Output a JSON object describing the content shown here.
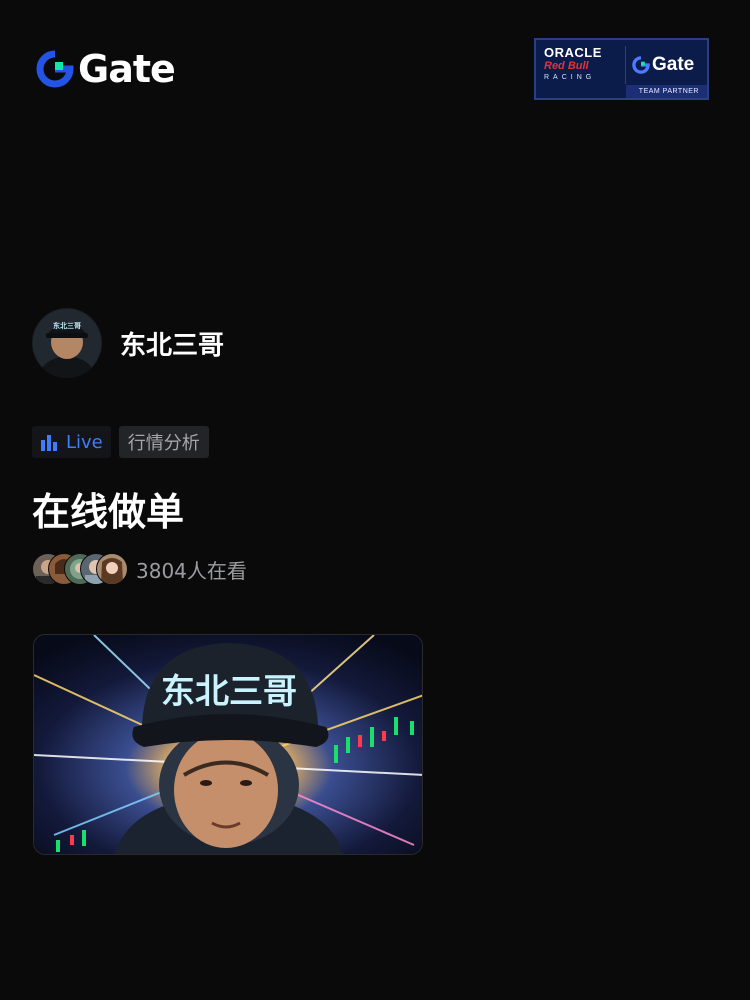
{
  "brand": {
    "name": "Gate",
    "logo_icon": "gate-logo-icon"
  },
  "partner_badge": {
    "oracle": "ORACLE",
    "redbull": "Red Bull",
    "racing": "RACING",
    "gate": "Gate",
    "team_partner": "TEAM PARTNER"
  },
  "host": {
    "name": "东北三哥",
    "avatar_cap_text": "东北三哥"
  },
  "stream": {
    "live_label": "Live",
    "live_icon": "bar-chart-icon",
    "category": "行情分析",
    "title": "在线做单",
    "viewer_count": "3804人在看",
    "thumbnail_cap_text": "东北三哥"
  },
  "colors": {
    "background": "#0a0a0a",
    "accent": "#3f7dff",
    "muted": "#9c9da1",
    "logo_green": "#17e5a7"
  }
}
